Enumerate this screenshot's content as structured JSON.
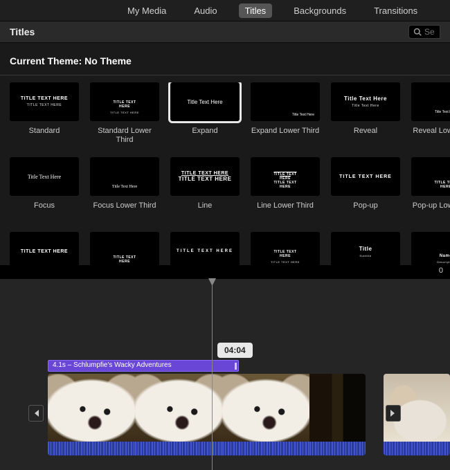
{
  "tabs": {
    "my_media": "My Media",
    "audio": "Audio",
    "titles": "Titles",
    "backgrounds": "Backgrounds",
    "transitions": "Transitions"
  },
  "subheader": {
    "title": "Titles"
  },
  "search": {
    "placeholder": "Se"
  },
  "theme": {
    "label": "Current Theme: No Theme"
  },
  "counter": "0",
  "tiles": [
    {
      "label": "Standard",
      "line1": "TITLE TEXT HERE",
      "line2": "TITLE TEXT HERE",
      "style": "std"
    },
    {
      "label": "Standard Lower Third",
      "line1": "TITLE TEXT HERE",
      "line2": "TITLE TEXT HERE",
      "style": "std-lower"
    },
    {
      "label": "Expand",
      "line1": "Title Text Here",
      "style": "expand",
      "selected": true
    },
    {
      "label": "Expand Lower Third",
      "line1": "Title Text Here",
      "style": "expand-lower"
    },
    {
      "label": "Reveal",
      "line1": "Title Text Here",
      "line2": "Title Text Here",
      "style": "reveal"
    },
    {
      "label": "Reveal Lower Third",
      "line1": "Title Text Here",
      "style": "reveal-lower"
    },
    {
      "label": "Focus",
      "line1": "Title Text Here",
      "style": "focus"
    },
    {
      "label": "Focus Lower Third",
      "line1": "Title Text Here",
      "style": "focus-lower"
    },
    {
      "label": "Line",
      "line1": "TITLE TEXT HERE",
      "line2": "TITLE TEXT HERE",
      "style": "line"
    },
    {
      "label": "Line Lower Third",
      "line1": "TITLE TEXT HERE",
      "line2": "TITLE TEXT HERE",
      "style": "line-lower"
    },
    {
      "label": "Pop-up",
      "line1": "TITLE TEXT HERE",
      "style": "popup"
    },
    {
      "label": "Pop-up Lower Third",
      "line1": "TITLE TEXT HERE",
      "style": "popup-lower"
    },
    {
      "label": "",
      "line1": "TITLE TEXT HERE",
      "style": "row3a"
    },
    {
      "label": "",
      "line1": "TITLE TEXT HERE",
      "style": "row3b"
    },
    {
      "label": "",
      "line1": "TITLE TEXT HERE",
      "style": "row3c"
    },
    {
      "label": "",
      "line1": "TITLE TEXT HERE",
      "line2": "TITLE TEXT HERE",
      "style": "row3d"
    },
    {
      "label": "",
      "line1": "Title",
      "line2": "Subtitle",
      "style": "row3e"
    },
    {
      "label": "",
      "line1": "Name",
      "line2": "Description",
      "style": "row3f"
    }
  ],
  "timeline": {
    "bubble": "04:04",
    "title_clip": "4.1s – Schlumpfie's Wacky Adventures"
  }
}
